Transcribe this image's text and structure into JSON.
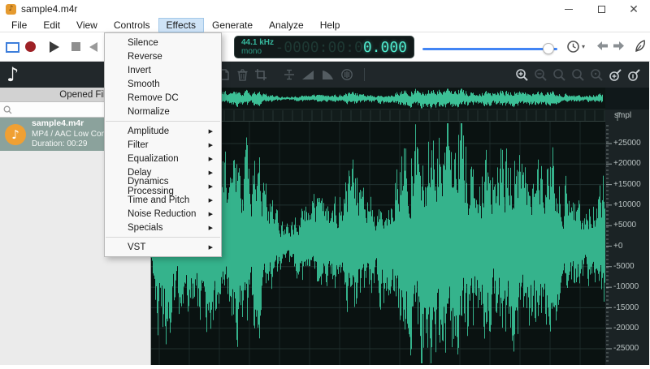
{
  "window": {
    "title": "sample4.m4r",
    "controls": {
      "minimize": "minimize",
      "maximize": "maximize",
      "close": "close"
    }
  },
  "menu_bar": {
    "items": [
      "File",
      "Edit",
      "View",
      "Controls",
      "Effects",
      "Generate",
      "Analyze",
      "Help"
    ],
    "active": "Effects"
  },
  "effects_menu": {
    "items": [
      {
        "label": "Silence",
        "arrow": ""
      },
      {
        "label": "Reverse",
        "arrow": ""
      },
      {
        "label": "Invert",
        "arrow": ""
      },
      {
        "label": "Smooth",
        "arrow": ""
      },
      {
        "label": "Remove DC",
        "arrow": ""
      },
      {
        "label": "Normalize",
        "arrow": ""
      },
      {
        "label": "Amplitude",
        "arrow": "▶"
      },
      {
        "label": "Filter",
        "arrow": "▶"
      },
      {
        "label": "Equalization",
        "arrow": "▶"
      },
      {
        "label": "Delay",
        "arrow": "▶"
      },
      {
        "label": "Dynamics Processing",
        "arrow": "▶"
      },
      {
        "label": "Time and Pitch",
        "arrow": "▶"
      },
      {
        "label": "Noise Reduction",
        "arrow": "▶"
      },
      {
        "label": "Specials",
        "arrow": "▶"
      },
      {
        "label": "VST",
        "arrow": "▶"
      }
    ]
  },
  "toolbar": {
    "lcd": {
      "sample_rate": "44.1 kHz",
      "channels": "mono",
      "ghost_digits": "-0000:00:0",
      "live_digits": "0.000"
    },
    "slider_percent": 90
  },
  "sidebar": {
    "panel_title": "Opened Files",
    "search_value": "",
    "file": {
      "name": "sample4.m4r",
      "format": "MP4 / AAC Low Complex",
      "duration": "Duration: 00:29"
    }
  },
  "waveform": {
    "ruler_unit": "smpl",
    "ruler_labels": [
      "+25000",
      "+20000",
      "+15000",
      "+10000",
      "+5000",
      "+0",
      "-5000",
      "-10000",
      "-15000",
      "-20000",
      "-25000"
    ],
    "colors": {
      "wave": "#35b38c",
      "wave_overview": "#3cc096",
      "grid_h": "#223130",
      "grid_v": "#1b2827",
      "tick": "#97a3a3",
      "timeline_line": "#273533"
    }
  },
  "icons": {
    "note-icon": "♪",
    "submenu-arrow-icon": "▶",
    "history-caret-icon": "▾"
  },
  "colors": {
    "accent_blue": "#4285f4",
    "selection_blue": "#3d7edb",
    "record_red": "#9e2126",
    "file_item_bg": "#8ba29c",
    "file_icon_orange": "#f0a033"
  }
}
